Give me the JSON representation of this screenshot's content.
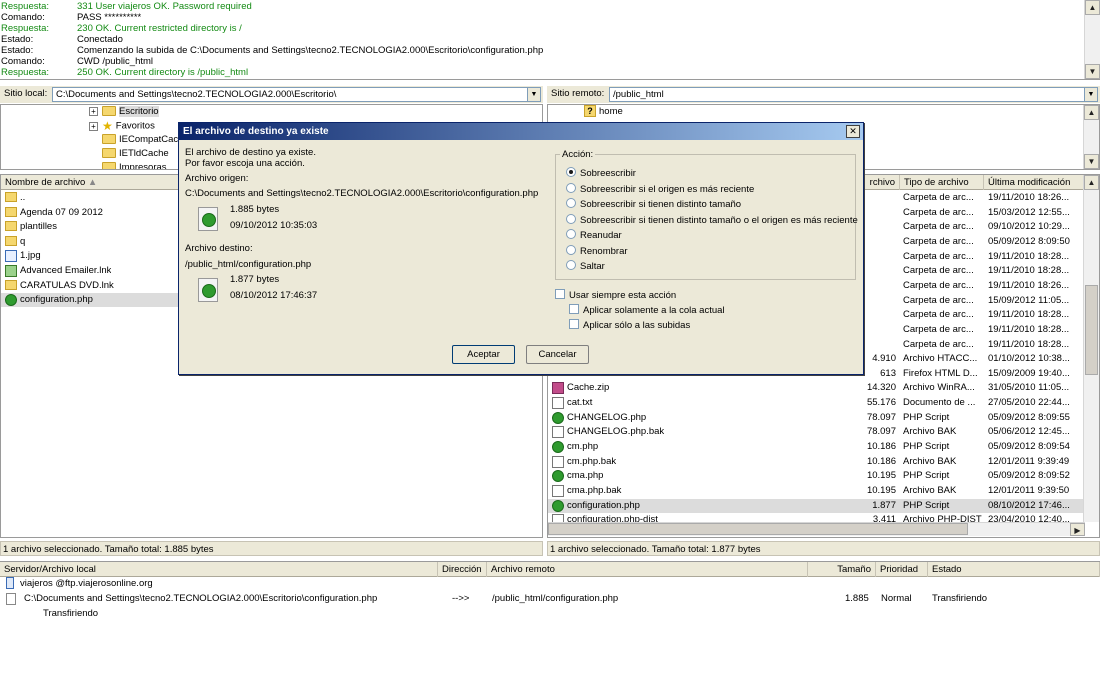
{
  "log": [
    {
      "key": "Respuesta:",
      "msg": "331 User  viajeros  OK. Password required",
      "green": true
    },
    {
      "key": "Comando:",
      "msg": "PASS **********",
      "green": false
    },
    {
      "key": "Respuesta:",
      "msg": "230 OK. Current restricted directory is /",
      "green": true
    },
    {
      "key": "Estado:",
      "msg": "Conectado",
      "green": false
    },
    {
      "key": "Estado:",
      "msg": "Comenzando la subida de C:\\Documents and Settings\\tecno2.TECNOLOGIA2.000\\Escritorio\\configuration.php",
      "green": false
    },
    {
      "key": "Comando:",
      "msg": "CWD /public_html",
      "green": false
    },
    {
      "key": "Respuesta:",
      "msg": "250 OK. Current directory is /public_html",
      "green": true
    }
  ],
  "local": {
    "label": "Sitio local:",
    "path": "C:\\Documents and Settings\\tecno2.TECNOLOGIA2.000\\Escritorio\\",
    "tree": [
      "Escritorio",
      "Favoritos",
      "IECompatCach",
      "IETldCache",
      "Impresoras"
    ],
    "columns": [
      "Nombre de archivo"
    ],
    "files": [
      {
        "name": "..",
        "icon": "folder"
      },
      {
        "name": "Agenda 07 09 2012",
        "icon": "folder"
      },
      {
        "name": "plantilles",
        "icon": "folder"
      },
      {
        "name": "q",
        "icon": "folder"
      },
      {
        "name": "1.jpg",
        "icon": "img"
      },
      {
        "name": "Advanced Emailer.lnk",
        "icon": "lnk"
      },
      {
        "name": "CARATULAS DVD.lnk",
        "icon": "folder"
      },
      {
        "name": "configuration.php",
        "icon": "php",
        "selected": true
      }
    ],
    "status": "1 archivo seleccionado. Tamaño total: 1.885 bytes"
  },
  "remote": {
    "label": "Sitio remoto:",
    "path": "/public_html",
    "tree": [
      "home"
    ],
    "columns": [
      "rchivo",
      "Tipo de archivo",
      "Última modificación"
    ],
    "files": [
      {
        "name": "",
        "size": "",
        "type": "Carpeta de arc...",
        "date": "19/11/2010 18:26...",
        "icon": ""
      },
      {
        "name": "",
        "size": "",
        "type": "Carpeta de arc...",
        "date": "15/03/2012 12:55...",
        "icon": ""
      },
      {
        "name": "",
        "size": "",
        "type": "Carpeta de arc...",
        "date": "09/10/2012 10:29...",
        "icon": ""
      },
      {
        "name": "",
        "size": "",
        "type": "Carpeta de arc...",
        "date": "05/09/2012 8:09:50",
        "icon": ""
      },
      {
        "name": "",
        "size": "",
        "type": "Carpeta de arc...",
        "date": "19/11/2010 18:28...",
        "icon": ""
      },
      {
        "name": "",
        "size": "",
        "type": "Carpeta de arc...",
        "date": "19/11/2010 18:28...",
        "icon": ""
      },
      {
        "name": "",
        "size": "",
        "type": "Carpeta de arc...",
        "date": "19/11/2010 18:26...",
        "icon": ""
      },
      {
        "name": "",
        "size": "",
        "type": "Carpeta de arc...",
        "date": "15/09/2012 11:05...",
        "icon": ""
      },
      {
        "name": "",
        "size": "",
        "type": "Carpeta de arc...",
        "date": "19/11/2010 18:28...",
        "icon": ""
      },
      {
        "name": "",
        "size": "",
        "type": "Carpeta de arc...",
        "date": "19/11/2010 18:28...",
        "icon": ""
      },
      {
        "name": "",
        "size": "",
        "type": "Carpeta de arc...",
        "date": "19/11/2010 18:28...",
        "icon": ""
      },
      {
        "name": "",
        "size": "4.910",
        "type": "Archivo HTACC...",
        "date": "01/10/2012 10:38...",
        "icon": ""
      },
      {
        "name": "",
        "size": "613",
        "type": "Firefox HTML D...",
        "date": "15/09/2009 19:40...",
        "icon": ""
      },
      {
        "name": "Cache.zip",
        "size": "14.320",
        "type": "Archivo WinRA...",
        "date": "31/05/2010 11:05...",
        "icon": "zip"
      },
      {
        "name": "cat.txt",
        "size": "55.176",
        "type": "Documento de ...",
        "date": "27/05/2010 22:44...",
        "icon": "doc"
      },
      {
        "name": "CHANGELOG.php",
        "size": "78.097",
        "type": "PHP Script",
        "date": "05/09/2012 8:09:55",
        "icon": "php"
      },
      {
        "name": "CHANGELOG.php.bak",
        "size": "78.097",
        "type": "Archivo BAK",
        "date": "05/06/2012 12:45...",
        "icon": "doc"
      },
      {
        "name": "cm.php",
        "size": "10.186",
        "type": "PHP Script",
        "date": "05/09/2012 8:09:54",
        "icon": "php"
      },
      {
        "name": "cm.php.bak",
        "size": "10.186",
        "type": "Archivo BAK",
        "date": "12/01/2011 9:39:49",
        "icon": "doc"
      },
      {
        "name": "cma.php",
        "size": "10.195",
        "type": "PHP Script",
        "date": "05/09/2012 8:09:52",
        "icon": "php"
      },
      {
        "name": "cma.php.bak",
        "size": "10.195",
        "type": "Archivo BAK",
        "date": "12/01/2011 9:39:50",
        "icon": "doc"
      },
      {
        "name": "configuration.php",
        "size": "1.877",
        "type": "PHP Script",
        "date": "08/10/2012 17:46...",
        "icon": "php",
        "selected": true
      },
      {
        "name": "configuration.php-dist",
        "size": "3.411",
        "type": "Archivo PHP-DIST",
        "date": "23/04/2010 12:40...",
        "icon": "doc"
      }
    ],
    "status": "1 archivo seleccionado. Tamaño total: 1.877 bytes"
  },
  "queue": {
    "columns": [
      "Servidor/Archivo local",
      "Dirección",
      "Archivo remoto",
      "Tamaño",
      "Prioridad",
      "Estado"
    ],
    "server": "viajeros @ftp.viajerosonline.org",
    "local_file": "C:\\Documents and Settings\\tecno2.TECNOLOGIA2.000\\Escritorio\\configuration.php",
    "direction": "-->>",
    "remote_file": "/public_html/configuration.php",
    "size": "1.885",
    "priority": "Normal",
    "state": "Transfiriendo",
    "sub_state": "Transfiriendo"
  },
  "dialog": {
    "title": "El archivo de destino ya existe",
    "close": "✕",
    "intro1": "El archivo de destino ya existe.",
    "intro2": "Por favor escoja una acción.",
    "source_label": "Archivo origen:",
    "source_path": "C:\\Documents and Settings\\tecno2.TECNOLOGIA2.000\\Escritorio\\configuration.php",
    "source_size": "1.885 bytes",
    "source_date": "09/10/2012 10:35:03",
    "dest_label": "Archivo destino:",
    "dest_path": "/public_html/configuration.php",
    "dest_size": "1.877 bytes",
    "dest_date": "08/10/2012 17:46:37",
    "action_label": "Acción:",
    "options": [
      "Sobreescribir",
      "Sobreescribir si el origen es más reciente",
      "Sobreescribir si tienen distinto tamaño",
      "Sobreescribir si tienen distinto tamaño o el origen es más reciente",
      "Reanudar",
      "Renombrar",
      "Saltar"
    ],
    "selected_option": 0,
    "always_label": "Usar siempre esta acción",
    "queue_only_label": "Aplicar solamente a la cola actual",
    "uploads_only_label": "Aplicar sólo a las subidas",
    "ok": "Aceptar",
    "cancel": "Cancelar"
  }
}
